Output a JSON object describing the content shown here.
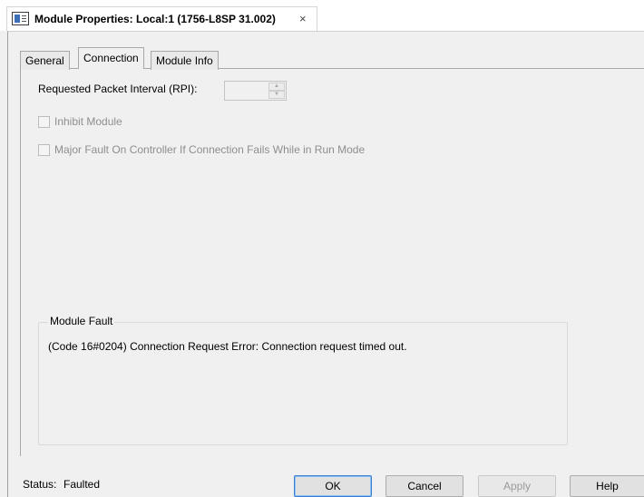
{
  "window": {
    "title": "Module Properties: Local:1 (1756-L8SP 31.002)",
    "close_glyph": "×",
    "icon": "module-properties-icon"
  },
  "tabs": [
    {
      "label": "General",
      "active": false
    },
    {
      "label": "Connection",
      "active": true
    },
    {
      "label": "Module Info",
      "active": false
    }
  ],
  "connection": {
    "rpi_label": "Requested Packet Interval (RPI):",
    "rpi_value": "",
    "inhibit_label": "Inhibit Module",
    "inhibit_checked": false,
    "major_fault_label": "Major Fault On Controller If Connection Fails While in Run Mode",
    "major_fault_checked": false
  },
  "module_fault": {
    "legend": "Module Fault",
    "message": "(Code 16#0204) Connection Request Error: Connection request timed out."
  },
  "status": {
    "label": "Status:",
    "value": "Faulted"
  },
  "buttons": {
    "ok": "OK",
    "cancel": "Cancel",
    "apply": "Apply",
    "help": "Help"
  },
  "colors": {
    "default_button_border": "#3b7ed6",
    "disabled_text": "#8e8e8e"
  }
}
